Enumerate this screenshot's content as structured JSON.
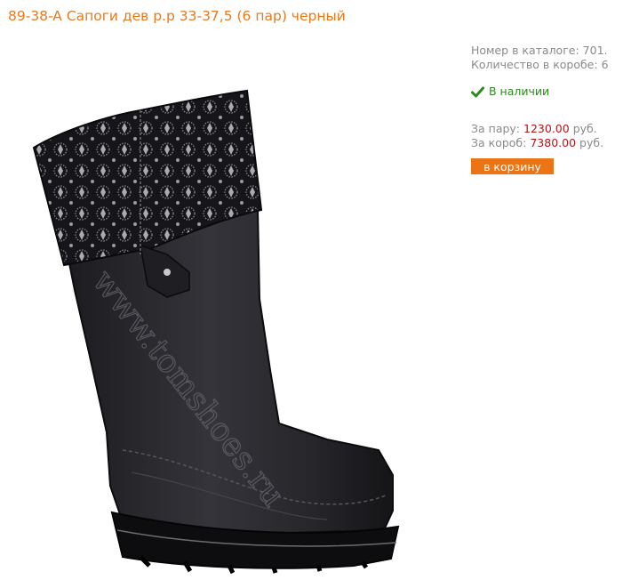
{
  "product": {
    "title": "89-38-A Сапоги дев р.р 33-37,5 (6 пар) черный"
  },
  "details": {
    "catalog_label": "Номер в каталоге:",
    "catalog_number": "701.",
    "box_qty_label": "Количество в коробе:",
    "box_qty_value": "6"
  },
  "stock": {
    "status": "В наличии",
    "icon": "checkmark-icon",
    "color": "#2c8a1f"
  },
  "pricing": {
    "pair_label": "За пару:",
    "pair_price": "1230.00",
    "box_label": "За короб:",
    "box_price": "7380.00",
    "currency": "руб.",
    "price_color": "#b4161b"
  },
  "cart": {
    "button_label": "в корзину",
    "button_color": "#ed7414"
  },
  "image": {
    "watermark": "www.tomshoes.ru"
  },
  "colors": {
    "title": "#e57a1e",
    "text": "#8a8a8a"
  }
}
